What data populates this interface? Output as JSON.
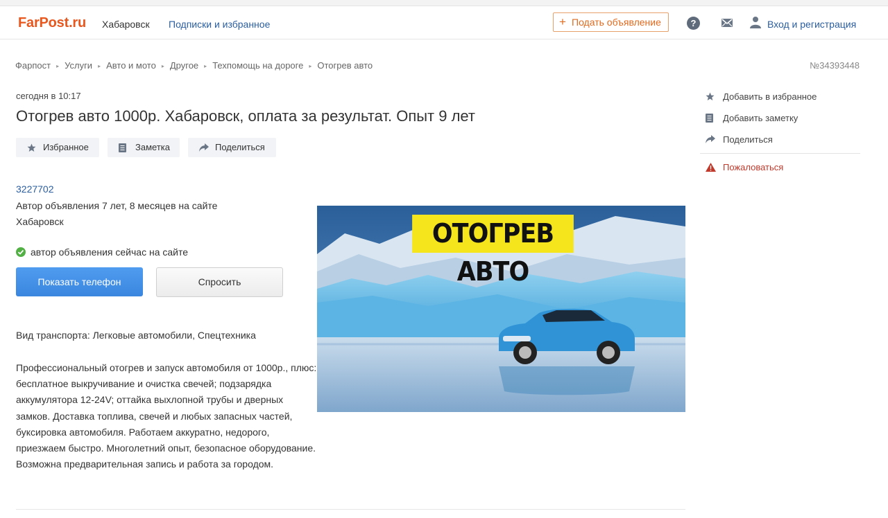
{
  "header": {
    "logo": "FarPost.ru",
    "city": "Хабаровск",
    "subscriptions": "Подписки и избранное",
    "post_ad_plus": "+",
    "post_ad": "Подать объявление",
    "help_glyph": "?",
    "login": "Вход и регистрация"
  },
  "breadcrumbs": [
    "Фарпост",
    "Услуги",
    "Авто и мото",
    "Другое",
    "Техпомощь на дороге",
    "Отогрев авто"
  ],
  "breadcrumb_sep": "▸",
  "ad": {
    "number": "№34393448",
    "date": "сегодня в 10:17",
    "title": "Отогрев авто 1000р. Хабаровск, оплата за результат. Опыт 9 лет",
    "actions": {
      "favorite": "Избранное",
      "note": "Заметка",
      "share": "Поделиться"
    },
    "author_id": "3227702",
    "author_age": "Автор объявления 7 лет, 8 месяцев на сайте",
    "author_city": "Хабаровск",
    "online_status": "автор объявления сейчас на сайте",
    "show_phone": "Показать телефон",
    "ask": "Спросить",
    "transport": "Вид транспорта: Легковые автомобили, Спецтехника",
    "description": "Профессиональный отогрев и запуск автомобиля от 1000р., плюс: бесплатное выкручивание и очистка свечей; подзарядка аккумулятора 12-24V; оттайка выхлопной трубы и дверных замков. Доставка топлива, свечей и любых запасных частей, буксировка автомобиля. Работаем аккуратно, недорого, приезжаем быстро. Многолетний опыт, безопасное оборудование. Возможна предварительная запись и работа за городом.",
    "image_banner": "ОТОГРЕВ АВТО"
  },
  "sidebar": {
    "add_favorite": "Добавить в избранное",
    "add_note": "Добавить заметку",
    "share": "Поделиться",
    "report": "Пожаловаться"
  },
  "colors": {
    "brand": "#e8571e",
    "link": "#2a5d9f",
    "primary_button": "#3e8ee8",
    "online": "#52b045",
    "report": "#c0392b"
  }
}
